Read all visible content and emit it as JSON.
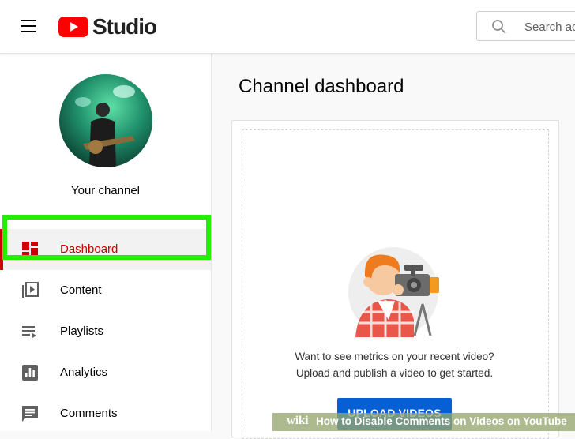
{
  "header": {
    "app_name": "Studio",
    "search_placeholder": "Search across your channel",
    "search_visible": "Search acr"
  },
  "sidebar": {
    "channel_label": "Your channel",
    "items": [
      {
        "label": "Dashboard",
        "icon": "dashboard-icon",
        "active": true
      },
      {
        "label": "Content",
        "icon": "content-icon",
        "active": false
      },
      {
        "label": "Playlists",
        "icon": "playlists-icon",
        "active": false
      },
      {
        "label": "Analytics",
        "icon": "analytics-icon",
        "active": false
      },
      {
        "label": "Comments",
        "icon": "comments-icon",
        "active": false
      }
    ]
  },
  "main": {
    "title": "Channel dashboard",
    "card": {
      "line1": "Want to see metrics on your recent video?",
      "line2": "Upload and publish a video to get started.",
      "button": "UPLOAD VIDEOS"
    }
  },
  "watermark": {
    "brand": "wiki",
    "title": "How to Disable Comments on Videos on YouTube"
  },
  "colors": {
    "brand_red": "#ff0000",
    "active_red": "#cc0000",
    "upload_blue": "#065fd4",
    "highlight_green": "#22ee00"
  }
}
